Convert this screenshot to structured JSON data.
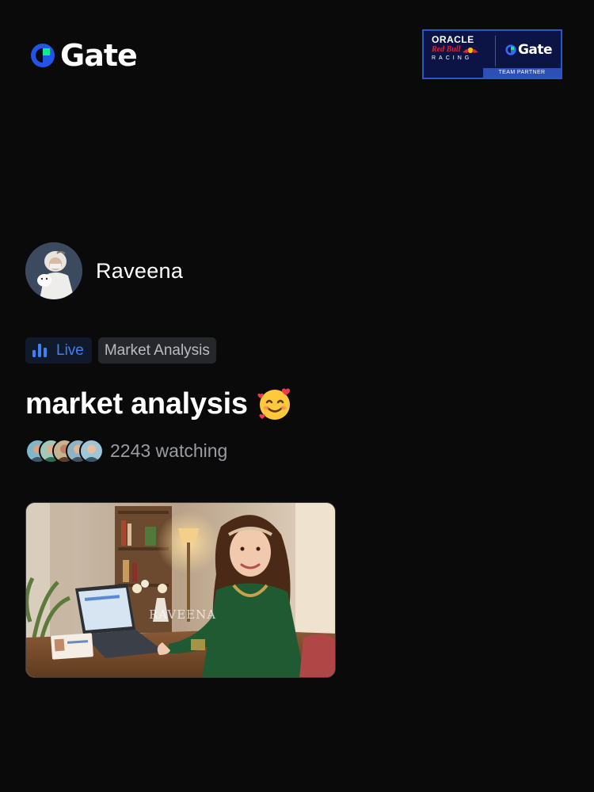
{
  "brand": {
    "logo_text": "Gate",
    "logo_icon": "gate-logo-icon",
    "accent_color": "#2354e6",
    "accent_green": "#17e68f"
  },
  "partner_badge": {
    "oracle": "ORACLE",
    "redbull": "Red Bull",
    "racing": "RACING",
    "gate": "Gate",
    "footer": "TEAM PARTNER"
  },
  "host": {
    "name": "Raveena",
    "avatar_icon": "host-avatar"
  },
  "tags": {
    "live_label": "Live",
    "live_icon": "bar-chart-icon",
    "live_color": "#3a82f7",
    "category_label": "Market Analysis"
  },
  "stream": {
    "title": "market analysis",
    "title_emoji": "smiling-face-with-hearts"
  },
  "viewers": {
    "count_text": "2243 watching",
    "avatar_count": 5
  },
  "thumbnail": {
    "watermark": "RAVEENA"
  }
}
